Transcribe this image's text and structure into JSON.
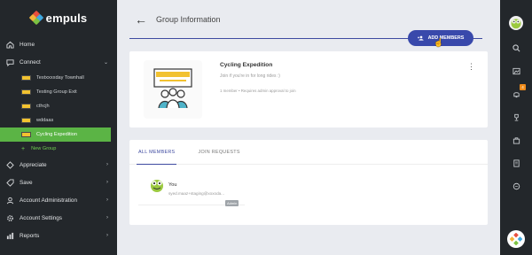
{
  "brand": {
    "name": "empuls"
  },
  "sidebar": {
    "items": [
      {
        "label": "Home",
        "icon": "home-icon"
      },
      {
        "label": "Connect",
        "icon": "connect-icon",
        "expanded": true
      },
      {
        "label": "Appreciate",
        "icon": "appreciate-icon"
      },
      {
        "label": "Save",
        "icon": "save-icon"
      },
      {
        "label": "Account Administration",
        "icon": "user-admin-icon"
      },
      {
        "label": "Account Settings",
        "icon": "gear-icon"
      },
      {
        "label": "Reports",
        "icon": "reports-icon"
      }
    ],
    "groups": [
      {
        "label": "Testxxxxday Townhall"
      },
      {
        "label": "Testing Group Exit"
      },
      {
        "label": "cthcjh"
      },
      {
        "label": "wddaas"
      },
      {
        "label": "Cycling Expedition",
        "active": true
      },
      {
        "label": "New Group",
        "new": true
      }
    ]
  },
  "header": {
    "title": "Group Information",
    "add_members": "ADD MEMBERS"
  },
  "group": {
    "name": "Cycling Expedition",
    "description": "Join if you're in for long rides :)",
    "members_count": "1 member",
    "approval": "Requires admin approval to join"
  },
  "tabs": {
    "all_members": "ALL MEMBERS",
    "join_requests": "JOIN REQUESTS"
  },
  "member": {
    "name": "You",
    "email": "syed.maaz+staging@xoxoda...",
    "role": "Admin"
  },
  "rail": {
    "notification_count": "4"
  },
  "colors": {
    "accent": "#3949ab",
    "active_green": "#5bb445",
    "sidebar_bg": "#23272b"
  }
}
